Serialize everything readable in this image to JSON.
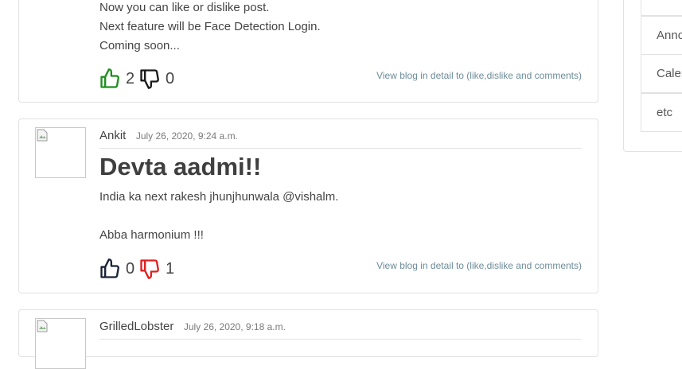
{
  "posts": [
    {
      "lines": [
        "Now you can like or dislike post.",
        "Next feature will be Face Detection Login.",
        "Coming soon..."
      ],
      "likes": "2",
      "dislikes": "0",
      "detail_link": "View blog in detail to (like,dislike and comments)",
      "like_color": "#1e8f1e",
      "dislike_color": "#1a1a1a"
    },
    {
      "author": "Ankit",
      "date": "July 26, 2020, 9:24 a.m.",
      "title": "Devta aadmi!!",
      "lines": [
        "India ka next rakesh jhunjhunwala @vishalm.",
        "",
        "Abba harmonium !!!"
      ],
      "likes": "0",
      "dislikes": "1",
      "detail_link": "View blog in detail to (like,dislike and comments)",
      "like_color": "#1a2238",
      "dislike_color": "#e02020"
    },
    {
      "author": "GrilledLobster",
      "date": "July 26, 2020, 9:18 a.m."
    }
  ],
  "sidebar": {
    "items": [
      "Anno",
      "Calen",
      "etc"
    ]
  }
}
